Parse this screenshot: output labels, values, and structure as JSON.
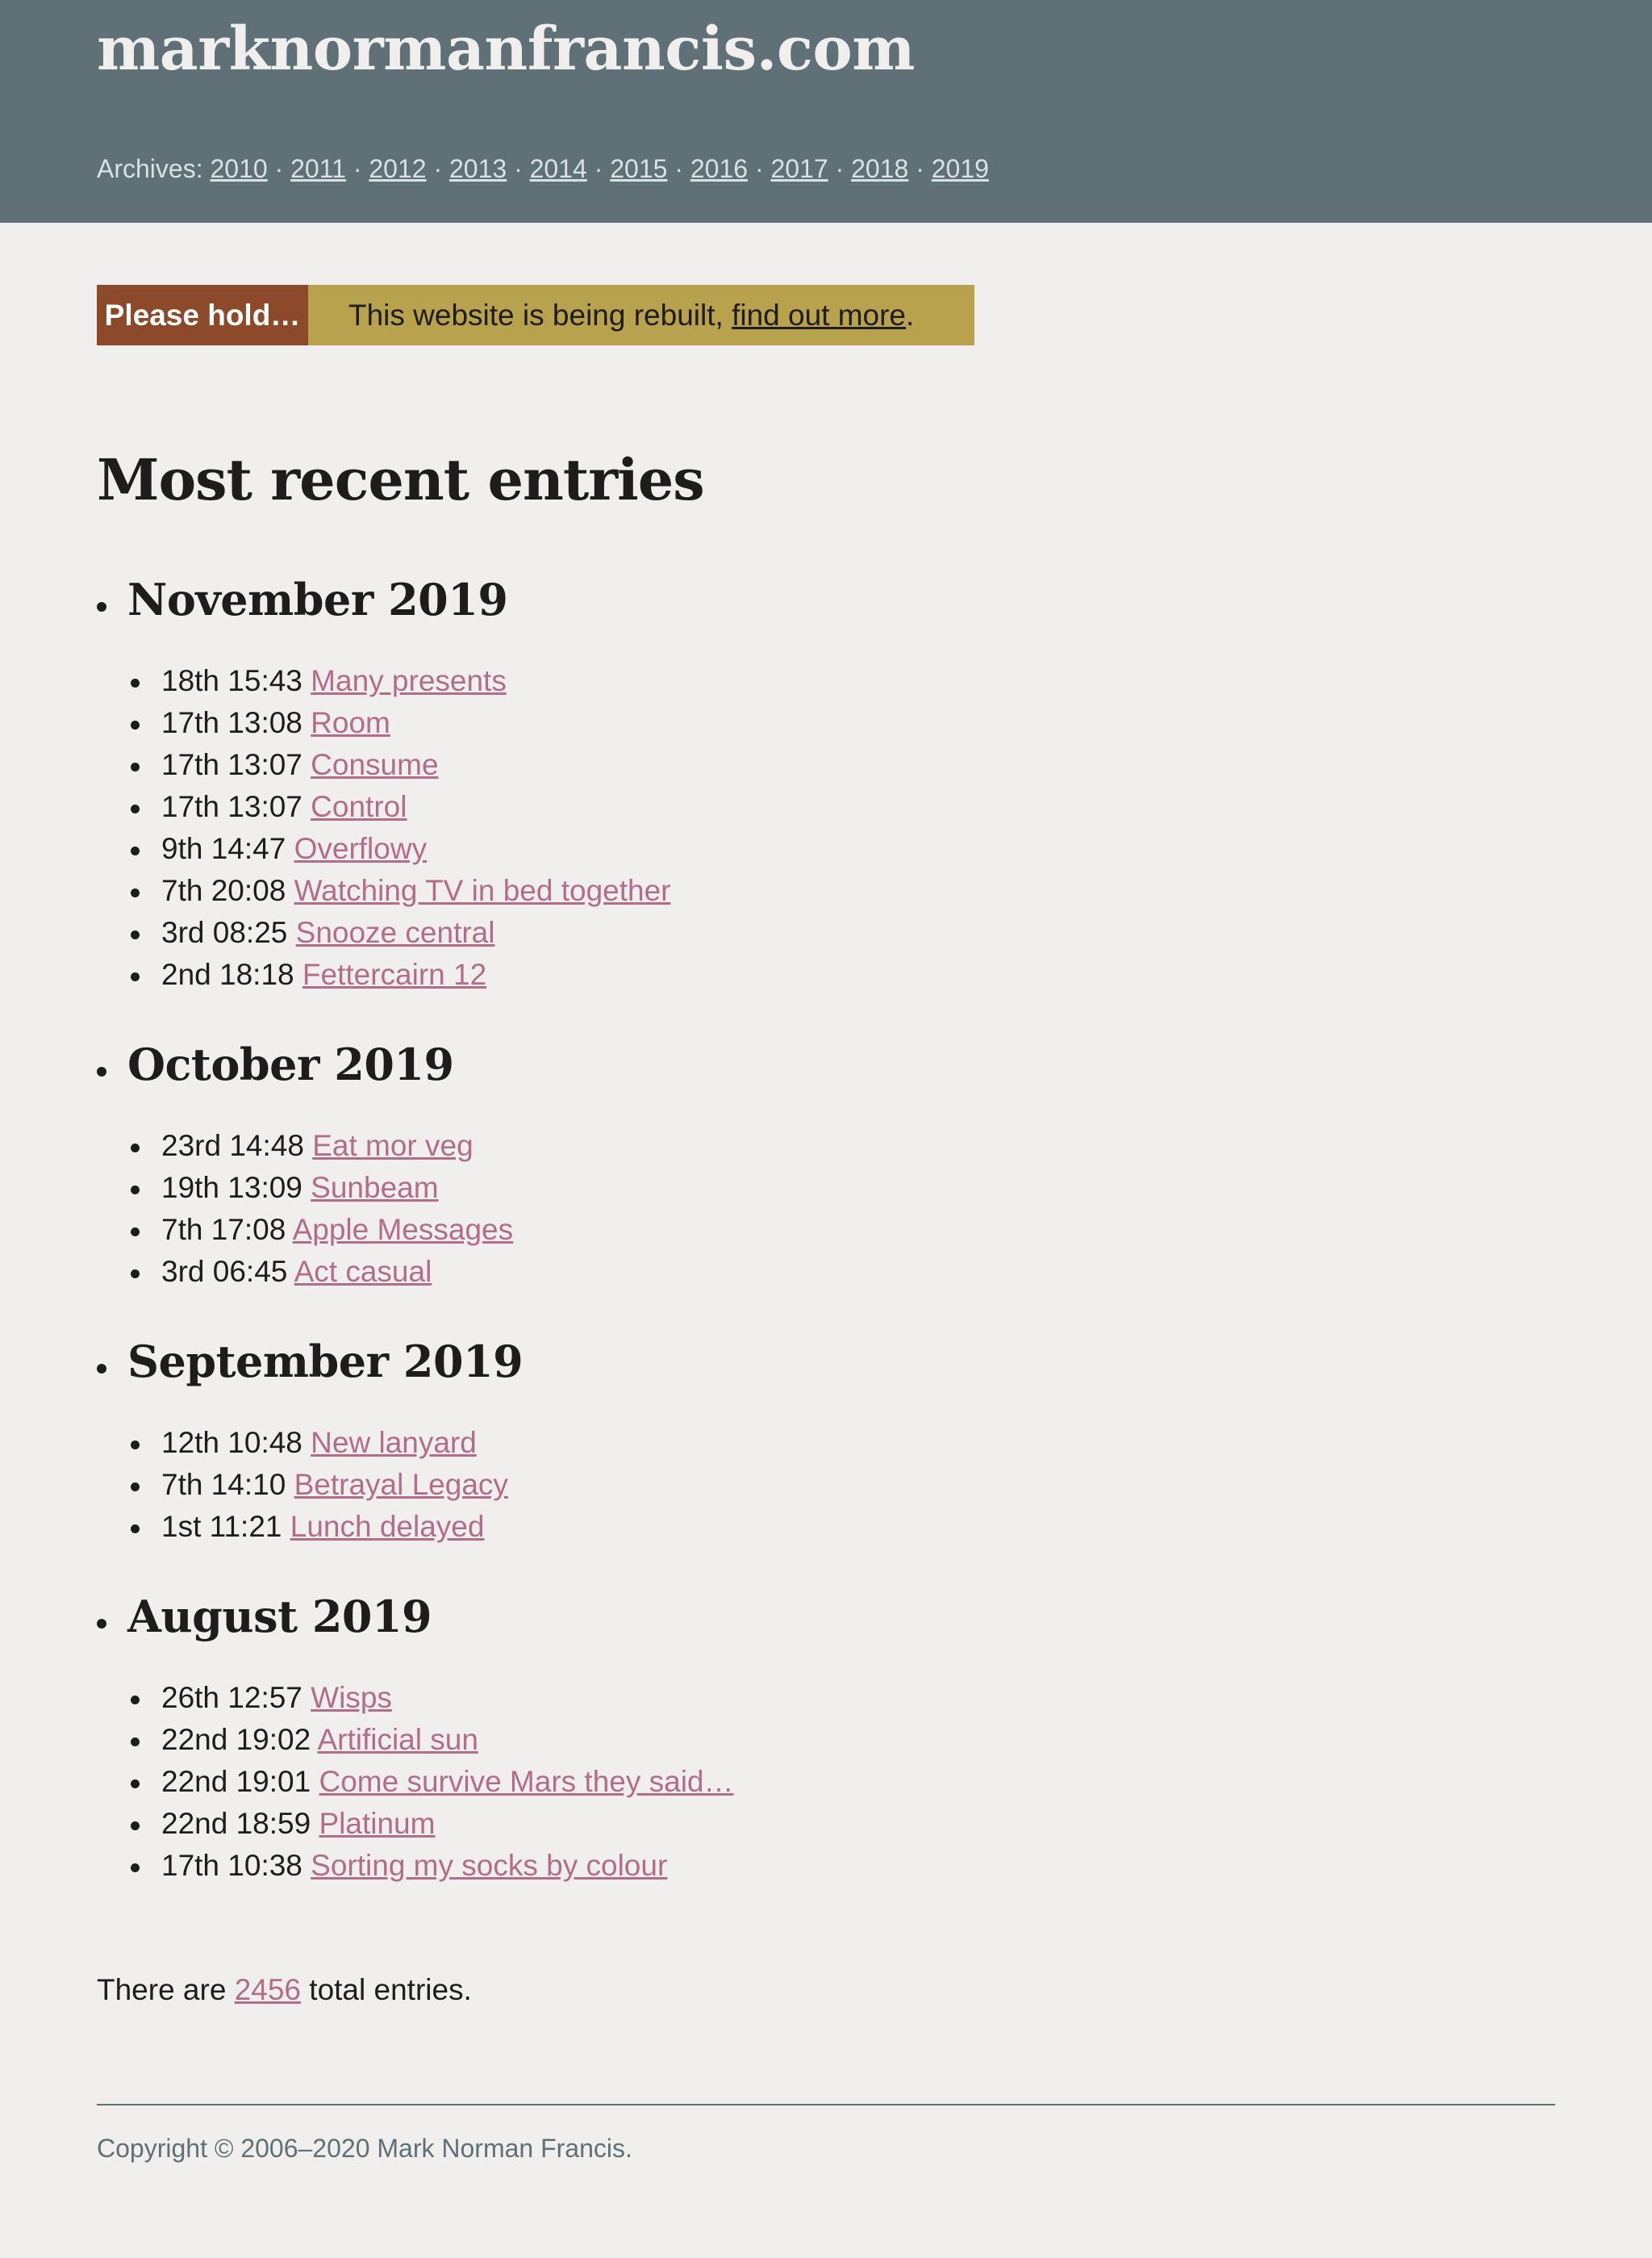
{
  "site": {
    "title": "marknormanfrancis.com"
  },
  "archives": {
    "label": "Archives:",
    "years": [
      "2010",
      "2011",
      "2012",
      "2013",
      "2014",
      "2015",
      "2016",
      "2017",
      "2018",
      "2019"
    ]
  },
  "notice": {
    "label": "Please hold…",
    "text_before": "This website is being rebuilt, ",
    "link_text": "find out more",
    "text_after": "."
  },
  "main": {
    "heading": "Most recent entries"
  },
  "months": [
    {
      "title": "November 2019",
      "entries": [
        {
          "time": "18th 15:43",
          "title": "Many presents"
        },
        {
          "time": "17th 13:08",
          "title": "Room"
        },
        {
          "time": "17th 13:07",
          "title": "Consume"
        },
        {
          "time": "17th 13:07",
          "title": "Control"
        },
        {
          "time": "9th 14:47",
          "title": "Overflowy"
        },
        {
          "time": "7th 20:08",
          "title": "Watching TV in bed together"
        },
        {
          "time": "3rd 08:25",
          "title": "Snooze central"
        },
        {
          "time": "2nd 18:18",
          "title": "Fettercairn 12"
        }
      ]
    },
    {
      "title": "October 2019",
      "entries": [
        {
          "time": "23rd 14:48",
          "title": "Eat mor veg"
        },
        {
          "time": "19th 13:09",
          "title": "Sunbeam"
        },
        {
          "time": "7th 17:08",
          "title": "Apple Messages"
        },
        {
          "time": "3rd 06:45",
          "title": "Act casual"
        }
      ]
    },
    {
      "title": "September 2019",
      "entries": [
        {
          "time": "12th 10:48",
          "title": "New lanyard"
        },
        {
          "time": "7th 14:10",
          "title": "Betrayal Legacy"
        },
        {
          "time": "1st 11:21",
          "title": "Lunch delayed"
        }
      ]
    },
    {
      "title": "August 2019",
      "entries": [
        {
          "time": "26th 12:57",
          "title": "Wisps"
        },
        {
          "time": "22nd 19:02",
          "title": "Artificial sun"
        },
        {
          "time": "22nd 19:01",
          "title": "Come survive Mars they said…"
        },
        {
          "time": "22nd 18:59",
          "title": "Platinum"
        },
        {
          "time": "17th 10:38",
          "title": "Sorting my socks by colour"
        }
      ]
    }
  ],
  "total": {
    "before": "There are ",
    "count": "2456",
    "after": " total entries."
  },
  "footer": {
    "copyright": "Copyright © 2006–2020 Mark Norman Francis."
  },
  "colors": {
    "masthead": "#5f7077",
    "background": "#f0efee",
    "link": "#b26d8b",
    "notice_label": "#8c4a2a",
    "notice_body": "#b9a24d"
  }
}
